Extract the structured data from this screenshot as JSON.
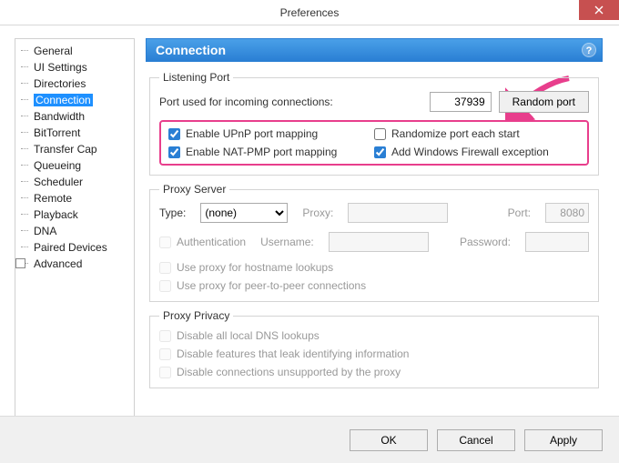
{
  "window": {
    "title": "Preferences"
  },
  "sidebar": {
    "items": [
      {
        "label": "General"
      },
      {
        "label": "UI Settings"
      },
      {
        "label": "Directories"
      },
      {
        "label": "Connection",
        "selected": true
      },
      {
        "label": "Bandwidth"
      },
      {
        "label": "BitTorrent"
      },
      {
        "label": "Transfer Cap"
      },
      {
        "label": "Queueing"
      },
      {
        "label": "Scheduler"
      },
      {
        "label": "Remote"
      },
      {
        "label": "Playback"
      },
      {
        "label": "DNA"
      },
      {
        "label": "Paired Devices"
      },
      {
        "label": "Advanced",
        "expandable": true
      }
    ]
  },
  "panel": {
    "title": "Connection",
    "help": "?"
  },
  "listening": {
    "legend": "Listening Port",
    "port_label": "Port used for incoming connections:",
    "port_value": "37939",
    "random_btn": "Random port",
    "upnp": "Enable UPnP port mapping",
    "natpmp": "Enable NAT-PMP port mapping",
    "randomize": "Randomize port each start",
    "firewall": "Add Windows Firewall exception"
  },
  "proxy": {
    "legend": "Proxy Server",
    "type_label": "Type:",
    "type_value": "(none)",
    "proxy_label": "Proxy:",
    "port_label": "Port:",
    "port_value": "8080",
    "auth": "Authentication",
    "user_label": "Username:",
    "pass_label": "Password:",
    "hostname": "Use proxy for hostname lookups",
    "p2p": "Use proxy for peer-to-peer connections"
  },
  "privacy": {
    "legend": "Proxy Privacy",
    "dns": "Disable all local DNS lookups",
    "leak": "Disable features that leak identifying information",
    "unsupported": "Disable connections unsupported by the proxy"
  },
  "footer": {
    "ok": "OK",
    "cancel": "Cancel",
    "apply": "Apply"
  }
}
